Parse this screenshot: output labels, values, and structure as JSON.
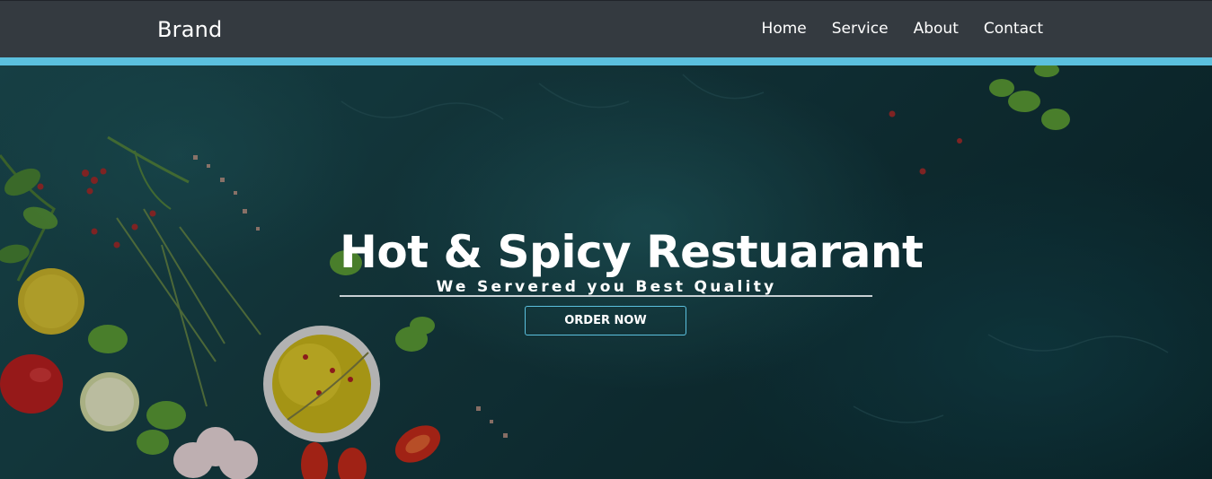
{
  "navbar": {
    "brand": "Brand",
    "links": [
      "Home",
      "Service",
      "About",
      "Contact"
    ]
  },
  "hero": {
    "title": "Hot & Spicy Restuarant",
    "subtitle": "We Servered you Best Quality",
    "cta_label": "ORDER NOW",
    "background_image": "food-ingredients-on-teal-stone"
  },
  "colors": {
    "navbar_bg": "#343a40",
    "accent": "#5bc0de",
    "hero_bg": "#14393f",
    "text": "#ffffff"
  }
}
